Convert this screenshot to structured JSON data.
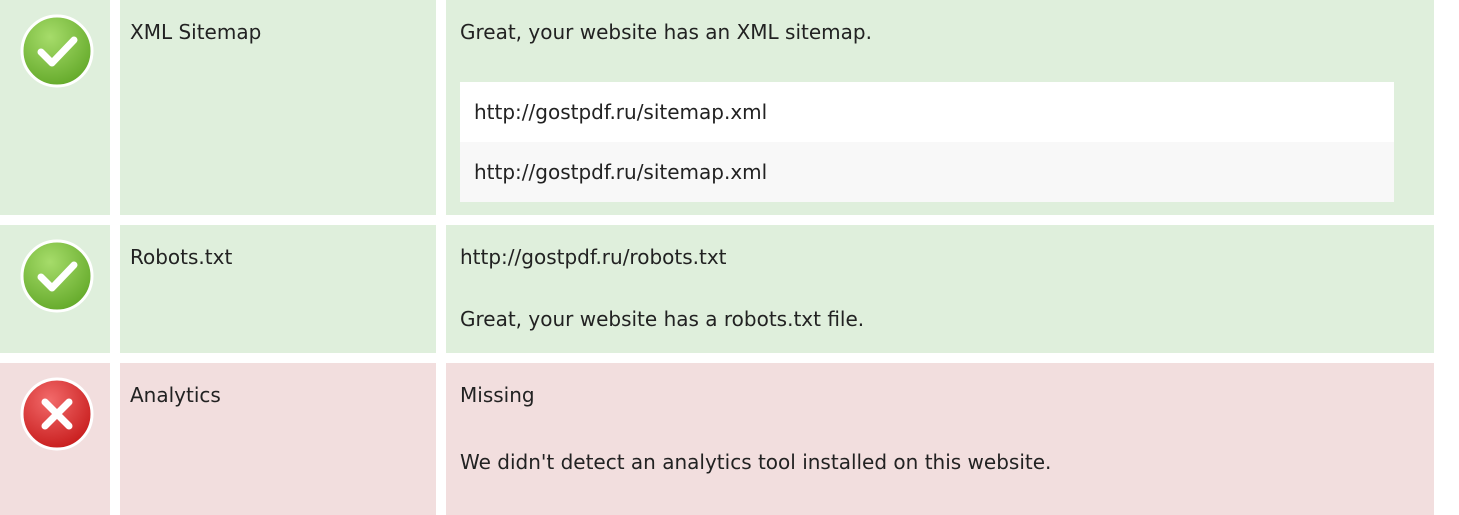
{
  "colors": {
    "pass_background": "#dfefdc",
    "fail_background": "#f2dede",
    "pass_icon": "#7cc140",
    "fail_icon": "#dd2f2f"
  },
  "checks": [
    {
      "status_icon": "check-icon",
      "name": "XML Sitemap",
      "message": "Great, your website has an XML sitemap.",
      "urls": [
        "http://gostpdf.ru/sitemap.xml",
        "http://gostpdf.ru/sitemap.xml"
      ]
    },
    {
      "status_icon": "check-icon",
      "name": "Robots.txt",
      "url": "http://gostpdf.ru/robots.txt",
      "message": "Great, your website has a robots.txt file."
    },
    {
      "status_icon": "cross-icon",
      "name": "Analytics",
      "status": "Missing",
      "message": "We didn't detect an analytics tool installed on this website."
    }
  ]
}
